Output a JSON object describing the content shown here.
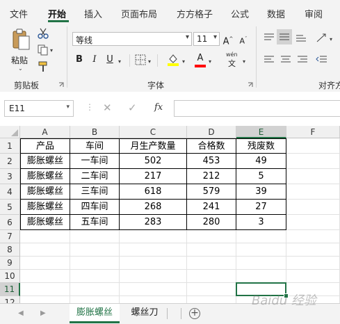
{
  "tabs": [
    "文件",
    "开始",
    "插入",
    "页面布局",
    "方方格子",
    "公式",
    "数据",
    "审阅"
  ],
  "active_tab": "开始",
  "accent_color": "#217346",
  "ribbon": {
    "clipboard": {
      "paste_label": "粘贴",
      "group_label": "剪贴板"
    },
    "font": {
      "font_name": "等线",
      "font_size": "11",
      "bold": "B",
      "italic": "I",
      "underline": "U",
      "grow": "A",
      "shrink": "A",
      "font_color_letter": "A",
      "pinyin": "wén",
      "group_label": "字体"
    },
    "alignment": {
      "group_label": "对齐方"
    }
  },
  "formula_bar": {
    "name_box": "E11",
    "cancel_symbol": "✕",
    "enter_symbol": "✓",
    "fx_symbol": "fx",
    "formula": ""
  },
  "columns": [
    "A",
    "B",
    "C",
    "D",
    "E",
    "F"
  ],
  "rows": [
    "1",
    "2",
    "3",
    "4",
    "5",
    "6",
    "7",
    "8",
    "9",
    "10",
    "11",
    "12"
  ],
  "selected_cell": {
    "col": "E",
    "row": "11"
  },
  "table": {
    "header": [
      "产品",
      "车间",
      "月生产数量",
      "合格数",
      "残废数"
    ],
    "rows": [
      [
        "膨胀螺丝",
        "一车间",
        "502",
        "453",
        "49"
      ],
      [
        "膨胀螺丝",
        "二车间",
        "217",
        "212",
        "5"
      ],
      [
        "膨胀螺丝",
        "三车间",
        "618",
        "579",
        "39"
      ],
      [
        "膨胀螺丝",
        "四车间",
        "268",
        "241",
        "27"
      ],
      [
        "膨胀螺丝",
        "五车间",
        "283",
        "280",
        "3"
      ]
    ]
  },
  "sheets": [
    "膨胀螺丝",
    "螺丝刀"
  ],
  "active_sheet": "膨胀螺丝",
  "add_sheet_symbol": "+",
  "watermark_text": "Baidu 经验"
}
